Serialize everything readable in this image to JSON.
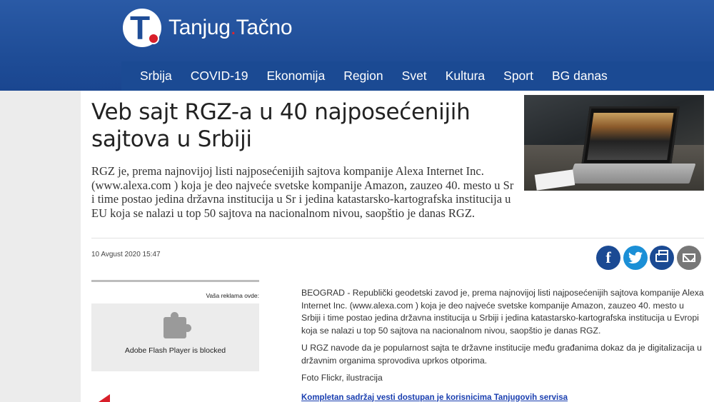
{
  "header": {
    "logo_letter": "T",
    "logo_main": "Tanjug",
    "logo_dot": ".",
    "logo_second": "Tačno"
  },
  "nav": {
    "items": [
      "Srbija",
      "COVID-19",
      "Ekonomija",
      "Region",
      "Svet",
      "Kultura",
      "Sport",
      "BG danas"
    ]
  },
  "article": {
    "title": "Veb sajt RGZ-a u 40 najposećenijih sajtova u Srbiji",
    "lead": "RGZ je, prema najnovijoj listi najposećenijih sajtova kompanije Alexa Internet Inc. (www.alexa.com ) koja je deo najveće svetske kompanije Amazon, zauzeo 40. mesto u Sr i time postao jedina državna institucija u Sr i jedina katastarsko-kartografska institucija u EU koja se nalazi u top 50 sajtova na nacionalnom nivou, saopštio je danas RGZ.",
    "date": "10 Avgust 2020 15:47",
    "paragraphs": [
      "BEOGRAD - Republički geodetski zavod je, prema najnovijoj listi najposećenijih sajtova kompanije Alexa Internet Inc. (www.alexa.com ) koja je deo najveće svetske kompanije Amazon, zauzeo 40. mesto u Srbiji i time postao jedina državna institucija u Srbiji i jedina katastarsko-kartografska institucija u Evropi koja se nalazi u top 50 sajtova na nacionalnom nivou, saopštio je danas RGZ.",
      "U RGZ navode da je popularnost sajta te državne institucije među građanima dokaz da je digitalizacija u državnim organima sprovodiva uprkos otporima.",
      "Foto Flickr, ilustracija"
    ],
    "subscriber_link": "Kompletan sadržaj vesti dostupan je korisnicima Tanjugovih servisa"
  },
  "share": {
    "facebook_glyph": "f",
    "twitter_glyph": "t"
  },
  "ad": {
    "label": "Vaša reklama ovde:",
    "blocked_text": "Adobe Flash Player is blocked"
  },
  "colors": {
    "header_blue": "#1f4d97",
    "accent_red": "#e0242d",
    "twitter_blue": "#1b8fd6"
  }
}
